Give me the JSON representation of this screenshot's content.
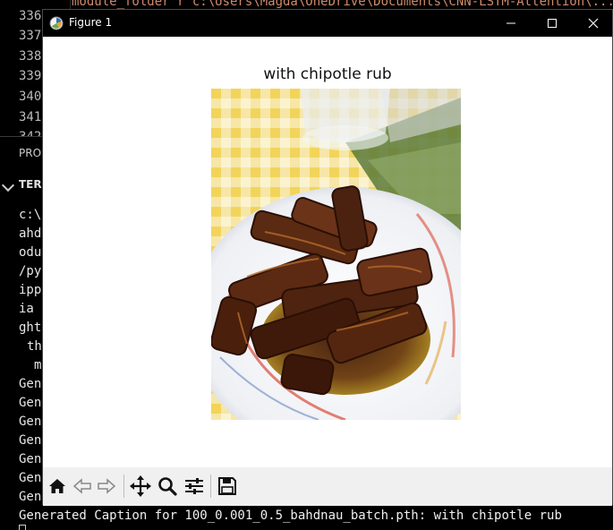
{
  "editor": {
    "top_fragment": "module_folder    r'c:\\Users\\Magda\\OneDrive\\Documents\\CNN-LSTM-Attention\\...",
    "line_numbers": [
      "336",
      "337",
      "338",
      "339",
      "340",
      "341",
      "342"
    ]
  },
  "panel": {
    "tab_label": "PROBLEMS",
    "terminal_label": "TERMINAL"
  },
  "terminal": {
    "lines": [
      "c:\\",
      "ahd",
      "odu",
      "/py",
      "ipp",
      "ia",
      "ght",
      "th",
      "m",
      "Gen",
      "Gen",
      "Gen",
      "Gen",
      "Gen",
      "Gen",
      "Gen"
    ],
    "caption_line": "Generated Caption for 100_0.001_0.5_bahdnau_batch.pth:  with chipotle rub"
  },
  "figure_window": {
    "title": "Figure 1",
    "plot_title": "with chipotle rub",
    "image_subject": "braised meat ribs with dark glaze on a white plate",
    "toolbar": [
      "home-icon",
      "back-icon",
      "forward-icon",
      "pan-icon",
      "zoom-icon",
      "configure-subplots-icon",
      "save-icon"
    ]
  },
  "colors": {
    "terminal_bg": "#000000",
    "toolbar_bg": "#f0f0f0",
    "accent_orange": "#d08a6a"
  }
}
